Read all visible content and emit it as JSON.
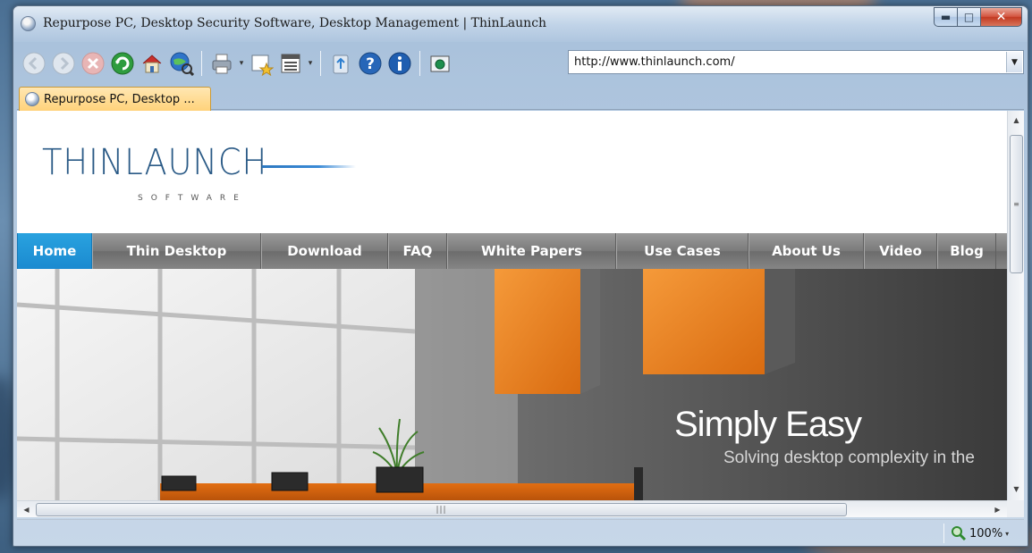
{
  "window": {
    "title": "Repurpose PC, Desktop Security Software, Desktop Management | ThinLaunch"
  },
  "toolbar": {
    "icons": [
      "back-arrow-icon",
      "forward-arrow-icon",
      "stop-icon",
      "refresh-icon",
      "home-icon",
      "globe-search-icon",
      "print-icon",
      "add-favorite-icon",
      "page-icon",
      "recycle-icon",
      "help-icon",
      "info-icon",
      "screenshot-icon"
    ]
  },
  "address": {
    "url": "http://www.thinlaunch.com/"
  },
  "tab": {
    "label": "Repurpose PC, Desktop ..."
  },
  "page": {
    "logo": {
      "word": "THINLAUNCH",
      "sub": "SOFTWARE"
    },
    "nav": [
      {
        "label": "Home",
        "active": true
      },
      {
        "label": "Thin Desktop",
        "active": false
      },
      {
        "label": "Download",
        "active": false
      },
      {
        "label": "FAQ",
        "active": false
      },
      {
        "label": "White Papers",
        "active": false
      },
      {
        "label": "Use Cases",
        "active": false
      },
      {
        "label": "About Us",
        "active": false
      },
      {
        "label": "Video",
        "active": false
      },
      {
        "label": "Blog",
        "active": false
      }
    ],
    "hero": {
      "title": "Simply Easy",
      "subtitle": "Solving desktop complexity in the"
    }
  },
  "statusbar": {
    "zoom": "100%"
  },
  "colors": {
    "nav_active": "#1b8ad0",
    "nav_bg": "#7a7a7a",
    "accent_orange": "#ef7f1a",
    "logo_blue": "#2a5a86"
  }
}
